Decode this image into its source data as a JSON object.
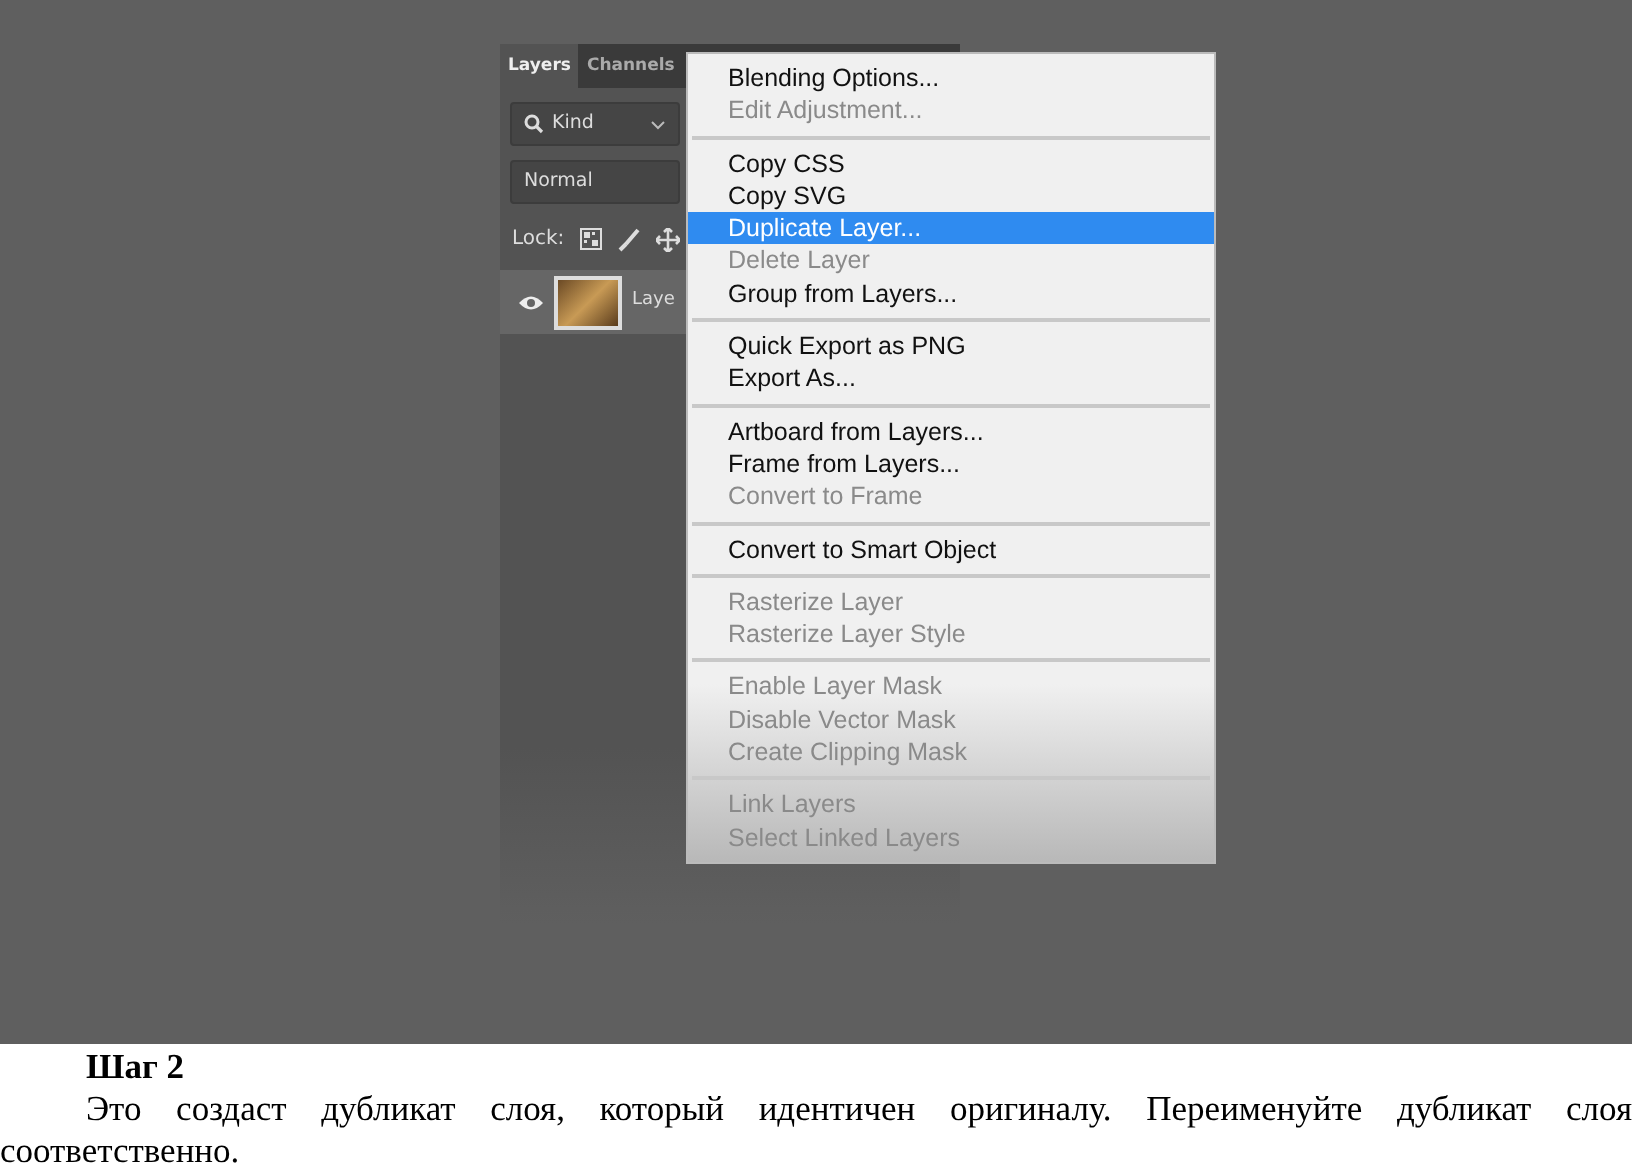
{
  "panel": {
    "tabs": [
      {
        "label": "Layers",
        "selected": true
      },
      {
        "label": "Channels",
        "selected": false
      }
    ],
    "filter": {
      "value": "Kind"
    },
    "blend_mode": {
      "value": "Normal"
    },
    "lock_label": "Lock:",
    "layers": [
      {
        "name": "Laye",
        "visible": true
      }
    ]
  },
  "context_menu": {
    "groups": [
      {
        "items": [
          {
            "label": "Blending Options...",
            "disabled": false,
            "selected": false
          },
          {
            "label": "Edit Adjustment...",
            "disabled": true,
            "selected": false
          }
        ]
      },
      {
        "items": [
          {
            "label": "Copy CSS",
            "disabled": false,
            "selected": false
          },
          {
            "label": "Copy SVG",
            "disabled": false,
            "selected": false
          },
          {
            "label": "Duplicate Layer...",
            "disabled": false,
            "selected": true
          },
          {
            "label": "Delete Layer",
            "disabled": true,
            "selected": false
          },
          {
            "label": "Group from Layers...",
            "disabled": false,
            "selected": false
          }
        ]
      },
      {
        "items": [
          {
            "label": "Quick Export as PNG",
            "disabled": false,
            "selected": false
          },
          {
            "label": "Export As...",
            "disabled": false,
            "selected": false
          }
        ]
      },
      {
        "items": [
          {
            "label": "Artboard from Layers...",
            "disabled": false,
            "selected": false
          },
          {
            "label": "Frame from Layers...",
            "disabled": false,
            "selected": false
          },
          {
            "label": "Convert to Frame",
            "disabled": true,
            "selected": false
          }
        ]
      },
      {
        "items": [
          {
            "label": "Convert to Smart Object",
            "disabled": false,
            "selected": false
          }
        ]
      },
      {
        "items": [
          {
            "label": "Rasterize Layer",
            "disabled": true,
            "selected": false
          },
          {
            "label": "Rasterize Layer Style",
            "disabled": true,
            "selected": false
          }
        ]
      },
      {
        "items": [
          {
            "label": "Enable Layer Mask",
            "disabled": true,
            "selected": false
          },
          {
            "label": "Disable Vector Mask",
            "disabled": true,
            "selected": false
          },
          {
            "label": "Create Clipping Mask",
            "disabled": true,
            "selected": false
          }
        ]
      },
      {
        "items": [
          {
            "label": "Link Layers",
            "disabled": true,
            "selected": false
          },
          {
            "label": "Select Linked Layers",
            "disabled": true,
            "selected": false
          }
        ]
      }
    ]
  },
  "step": {
    "heading": "Шаг 2",
    "text": "Это создаст дубликат слоя, который идентичен оригиналу. Переименуйте дубликат слоя соответственно."
  }
}
